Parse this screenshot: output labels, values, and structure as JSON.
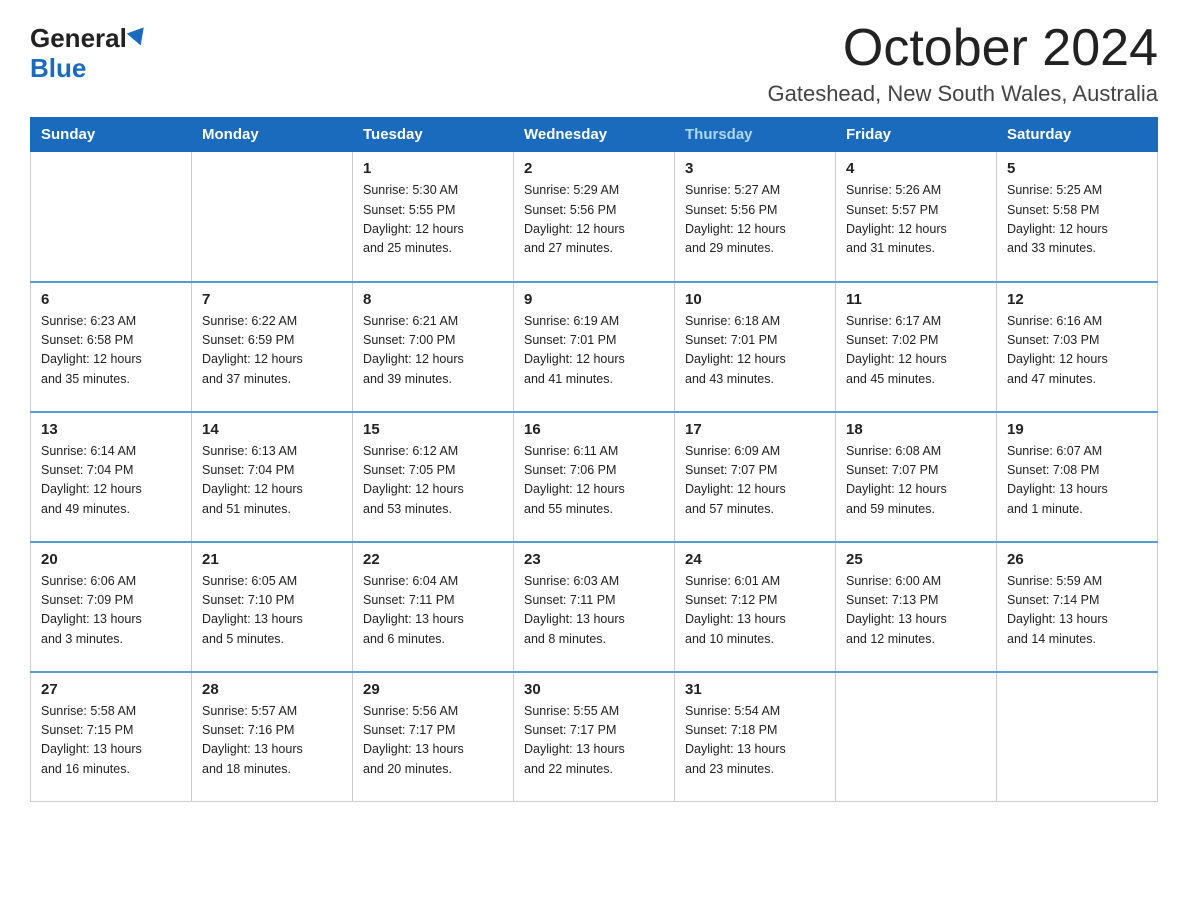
{
  "logo": {
    "general": "General",
    "blue": "Blue"
  },
  "title": "October 2024",
  "location": "Gateshead, New South Wales, Australia",
  "days_of_week": [
    "Sunday",
    "Monday",
    "Tuesday",
    "Wednesday",
    "Thursday",
    "Friday",
    "Saturday"
  ],
  "weeks": [
    [
      {
        "day": "",
        "info": ""
      },
      {
        "day": "",
        "info": ""
      },
      {
        "day": "1",
        "info": "Sunrise: 5:30 AM\nSunset: 5:55 PM\nDaylight: 12 hours\nand 25 minutes."
      },
      {
        "day": "2",
        "info": "Sunrise: 5:29 AM\nSunset: 5:56 PM\nDaylight: 12 hours\nand 27 minutes."
      },
      {
        "day": "3",
        "info": "Sunrise: 5:27 AM\nSunset: 5:56 PM\nDaylight: 12 hours\nand 29 minutes."
      },
      {
        "day": "4",
        "info": "Sunrise: 5:26 AM\nSunset: 5:57 PM\nDaylight: 12 hours\nand 31 minutes."
      },
      {
        "day": "5",
        "info": "Sunrise: 5:25 AM\nSunset: 5:58 PM\nDaylight: 12 hours\nand 33 minutes."
      }
    ],
    [
      {
        "day": "6",
        "info": "Sunrise: 6:23 AM\nSunset: 6:58 PM\nDaylight: 12 hours\nand 35 minutes."
      },
      {
        "day": "7",
        "info": "Sunrise: 6:22 AM\nSunset: 6:59 PM\nDaylight: 12 hours\nand 37 minutes."
      },
      {
        "day": "8",
        "info": "Sunrise: 6:21 AM\nSunset: 7:00 PM\nDaylight: 12 hours\nand 39 minutes."
      },
      {
        "day": "9",
        "info": "Sunrise: 6:19 AM\nSunset: 7:01 PM\nDaylight: 12 hours\nand 41 minutes."
      },
      {
        "day": "10",
        "info": "Sunrise: 6:18 AM\nSunset: 7:01 PM\nDaylight: 12 hours\nand 43 minutes."
      },
      {
        "day": "11",
        "info": "Sunrise: 6:17 AM\nSunset: 7:02 PM\nDaylight: 12 hours\nand 45 minutes."
      },
      {
        "day": "12",
        "info": "Sunrise: 6:16 AM\nSunset: 7:03 PM\nDaylight: 12 hours\nand 47 minutes."
      }
    ],
    [
      {
        "day": "13",
        "info": "Sunrise: 6:14 AM\nSunset: 7:04 PM\nDaylight: 12 hours\nand 49 minutes."
      },
      {
        "day": "14",
        "info": "Sunrise: 6:13 AM\nSunset: 7:04 PM\nDaylight: 12 hours\nand 51 minutes."
      },
      {
        "day": "15",
        "info": "Sunrise: 6:12 AM\nSunset: 7:05 PM\nDaylight: 12 hours\nand 53 minutes."
      },
      {
        "day": "16",
        "info": "Sunrise: 6:11 AM\nSunset: 7:06 PM\nDaylight: 12 hours\nand 55 minutes."
      },
      {
        "day": "17",
        "info": "Sunrise: 6:09 AM\nSunset: 7:07 PM\nDaylight: 12 hours\nand 57 minutes."
      },
      {
        "day": "18",
        "info": "Sunrise: 6:08 AM\nSunset: 7:07 PM\nDaylight: 12 hours\nand 59 minutes."
      },
      {
        "day": "19",
        "info": "Sunrise: 6:07 AM\nSunset: 7:08 PM\nDaylight: 13 hours\nand 1 minute."
      }
    ],
    [
      {
        "day": "20",
        "info": "Sunrise: 6:06 AM\nSunset: 7:09 PM\nDaylight: 13 hours\nand 3 minutes."
      },
      {
        "day": "21",
        "info": "Sunrise: 6:05 AM\nSunset: 7:10 PM\nDaylight: 13 hours\nand 5 minutes."
      },
      {
        "day": "22",
        "info": "Sunrise: 6:04 AM\nSunset: 7:11 PM\nDaylight: 13 hours\nand 6 minutes."
      },
      {
        "day": "23",
        "info": "Sunrise: 6:03 AM\nSunset: 7:11 PM\nDaylight: 13 hours\nand 8 minutes."
      },
      {
        "day": "24",
        "info": "Sunrise: 6:01 AM\nSunset: 7:12 PM\nDaylight: 13 hours\nand 10 minutes."
      },
      {
        "day": "25",
        "info": "Sunrise: 6:00 AM\nSunset: 7:13 PM\nDaylight: 13 hours\nand 12 minutes."
      },
      {
        "day": "26",
        "info": "Sunrise: 5:59 AM\nSunset: 7:14 PM\nDaylight: 13 hours\nand 14 minutes."
      }
    ],
    [
      {
        "day": "27",
        "info": "Sunrise: 5:58 AM\nSunset: 7:15 PM\nDaylight: 13 hours\nand 16 minutes."
      },
      {
        "day": "28",
        "info": "Sunrise: 5:57 AM\nSunset: 7:16 PM\nDaylight: 13 hours\nand 18 minutes."
      },
      {
        "day": "29",
        "info": "Sunrise: 5:56 AM\nSunset: 7:17 PM\nDaylight: 13 hours\nand 20 minutes."
      },
      {
        "day": "30",
        "info": "Sunrise: 5:55 AM\nSunset: 7:17 PM\nDaylight: 13 hours\nand 22 minutes."
      },
      {
        "day": "31",
        "info": "Sunrise: 5:54 AM\nSunset: 7:18 PM\nDaylight: 13 hours\nand 23 minutes."
      },
      {
        "day": "",
        "info": ""
      },
      {
        "day": "",
        "info": ""
      }
    ]
  ]
}
